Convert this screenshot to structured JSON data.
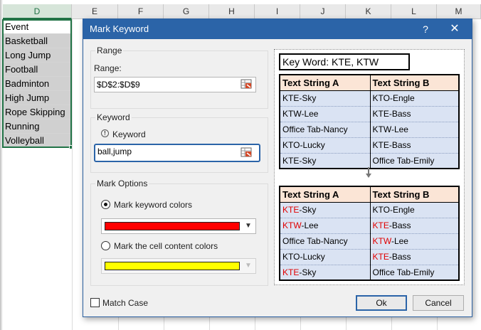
{
  "sheet": {
    "columns": [
      "D",
      "E",
      "F",
      "G",
      "H",
      "I",
      "J",
      "K",
      "L",
      "M"
    ],
    "cells": [
      "Event",
      "Basketball",
      "Long Jump",
      "Football",
      "Badminton",
      "High Jump",
      "Rope Skipping",
      "Running",
      "Volleyball"
    ]
  },
  "dialog": {
    "title": "Mark Keyword",
    "help": "?",
    "close": "✕",
    "range_group": "Range",
    "range_label": "Range:",
    "range_value": "$D$2:$D$9",
    "keyword_group": "Keyword",
    "keyword_label": "Keyword",
    "keyword_value": "ball,jump",
    "mark_group": "Mark Options",
    "radio1": "Mark keyword colors",
    "radio2": "Mark the cell content colors",
    "color1": "#ff0000",
    "color2": "#ffff00",
    "match_case": "Match Case",
    "ok": "Ok",
    "cancel": "Cancel"
  },
  "preview": {
    "keyword_line": "Key Word: KTE, KTW",
    "headers": [
      "Text String A",
      "Text String B"
    ],
    "before": [
      [
        "KTE-Sky",
        "KTO-Engle"
      ],
      [
        "KTW-Lee",
        "KTE-Bass"
      ],
      [
        "Office Tab-Nancy",
        "KTW-Lee"
      ],
      [
        "KTO-Lucky",
        "KTE-Bass"
      ],
      [
        "KTE-Sky",
        "Office Tab-Emily"
      ]
    ],
    "after": [
      [
        {
          "hl": "KTE",
          "rest": "-Sky"
        },
        {
          "hl": "",
          "rest": "KTO-Engle"
        }
      ],
      [
        {
          "hl": "KTW",
          "rest": "-Lee"
        },
        {
          "hl": "KTE",
          "rest": "-Bass"
        }
      ],
      [
        {
          "hl": "",
          "rest": "Office Tab-Nancy"
        },
        {
          "hl": "KTW",
          "rest": "-Lee"
        }
      ],
      [
        {
          "hl": "",
          "rest": "KTO-Lucky"
        },
        {
          "hl": "KTE",
          "rest": "-Bass"
        }
      ],
      [
        {
          "hl": "KTE",
          "rest": "-Sky"
        },
        {
          "hl": "",
          "rest": "Office Tab-Emily"
        }
      ]
    ]
  }
}
